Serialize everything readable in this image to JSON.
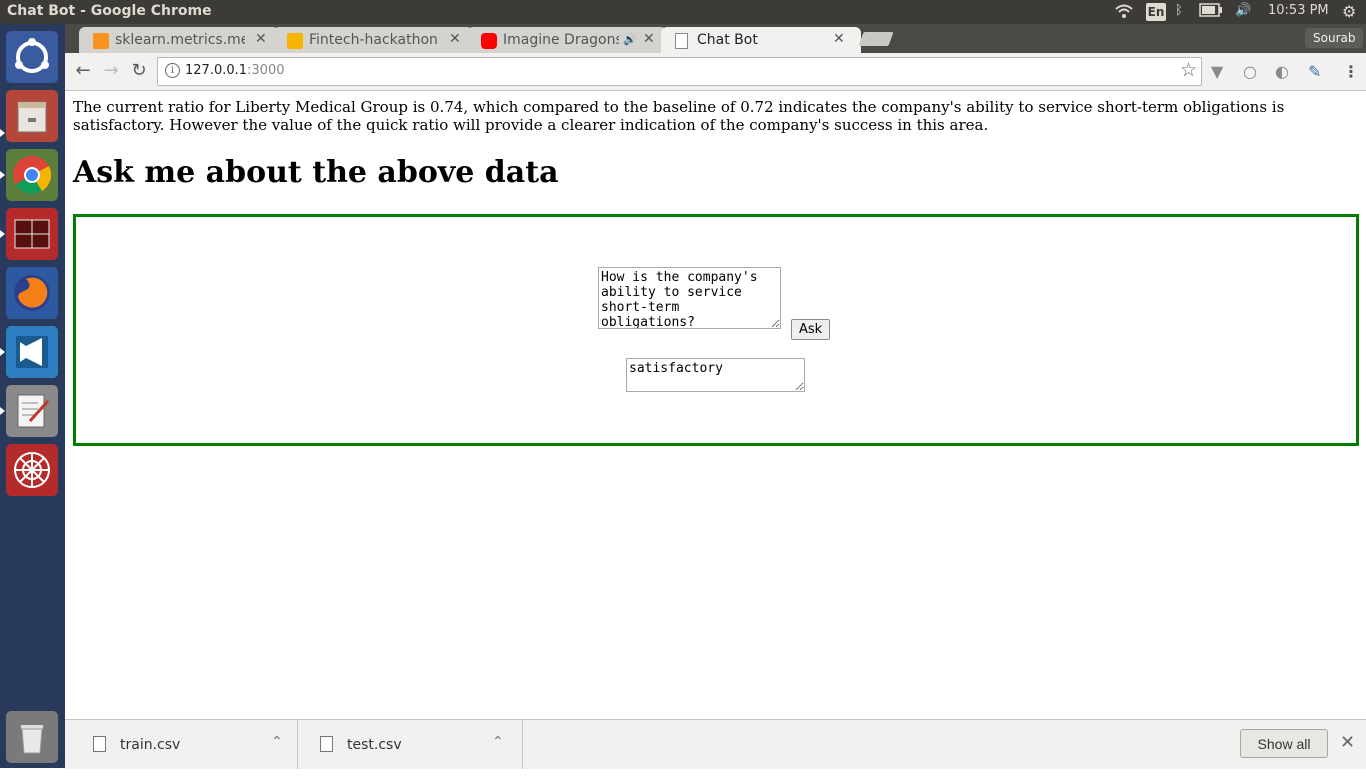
{
  "window": {
    "title": "Chat Bot - Google Chrome"
  },
  "system_tray": {
    "language": "En",
    "clock": "10:53 PM",
    "icons": [
      "wifi-icon",
      "bluetooth-icon",
      "battery-icon",
      "volume-icon",
      "settings-icon"
    ]
  },
  "launcher": {
    "items": [
      {
        "name": "ubuntu-dash",
        "icon": "ubuntu-logo-icon",
        "color": "#3a5ba0"
      },
      {
        "name": "files",
        "icon": "file-cabinet-icon",
        "color": "#b5463a"
      },
      {
        "name": "chrome",
        "icon": "chrome-icon",
        "color": "#4a7a3a"
      },
      {
        "name": "terminal",
        "icon": "terminal-icon",
        "color": "#b52a2a"
      },
      {
        "name": "firefox",
        "icon": "firefox-icon",
        "color": "#d9721c"
      },
      {
        "name": "vscode",
        "icon": "vscode-icon",
        "color": "#2d7fc1"
      },
      {
        "name": "text-editor",
        "icon": "text-editor-icon",
        "color": "#8a8a8a"
      },
      {
        "name": "network-tool",
        "icon": "spider-web-icon",
        "color": "#b52a2a"
      },
      {
        "name": "trash",
        "icon": "trash-icon",
        "color": "#7a7a7a"
      }
    ]
  },
  "browser": {
    "tabs": [
      {
        "label": "sklearn.metrics.me",
        "favicon": "#f7931e",
        "active": false
      },
      {
        "label": "Fintech-hackathon",
        "favicon": "#f4b400",
        "active": false
      },
      {
        "label": "Imagine Dragons",
        "favicon": "#ff0000",
        "active": false,
        "audio": true
      },
      {
        "label": "Chat Bot",
        "favicon": "#ffffff",
        "active": true
      }
    ],
    "profile": "Sourab",
    "url": {
      "host": "127.0.0.1",
      "port": ":3000"
    }
  },
  "page": {
    "paragraph": "The current ratio for Liberty Medical Group is 0.74, which compared to the baseline of 0.72 indicates the company's ability to service short-term obligations is satisfactory. However the value of the quick ratio will provide a clearer indication of the company's success in this area.",
    "heading": "Ask me about the above data",
    "question": "How is the company's ability to service short-term obligations?",
    "ask_label": "Ask",
    "answer": "satisfactory",
    "accent": "#008000"
  },
  "downloads": {
    "items": [
      {
        "name": "train.csv"
      },
      {
        "name": "test.csv"
      }
    ],
    "show_all_label": "Show all"
  }
}
